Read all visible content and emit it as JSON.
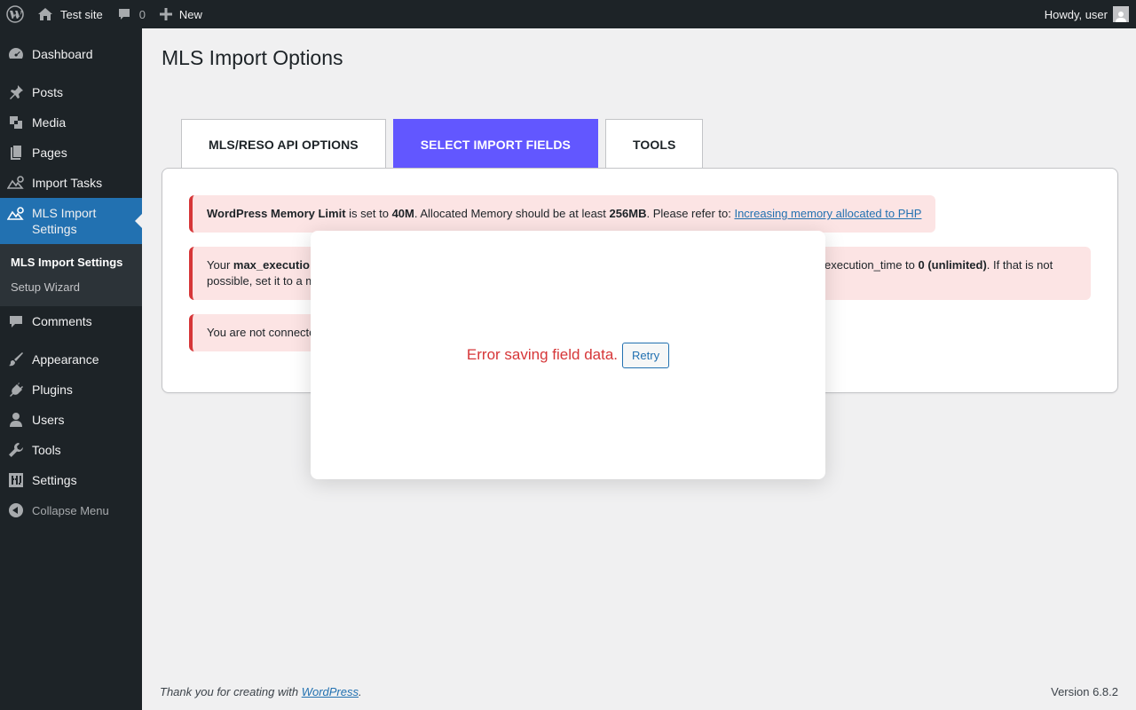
{
  "adminbar": {
    "site_name": "Test site",
    "comments_count": "0",
    "new_label": "New",
    "howdy": "Howdy, user"
  },
  "sidebar": {
    "items": [
      {
        "label": "Dashboard",
        "icon": "dashboard-icon"
      },
      {
        "label": "Posts",
        "icon": "pin-icon"
      },
      {
        "label": "Media",
        "icon": "media-icon"
      },
      {
        "label": "Pages",
        "icon": "pages-icon"
      },
      {
        "label": "Import Tasks",
        "icon": "import-icon"
      },
      {
        "label": "MLS Import Settings",
        "icon": "import-icon"
      },
      {
        "label": "Comments",
        "icon": "comment-icon"
      },
      {
        "label": "Appearance",
        "icon": "brush-icon"
      },
      {
        "label": "Plugins",
        "icon": "plugin-icon"
      },
      {
        "label": "Users",
        "icon": "user-icon"
      },
      {
        "label": "Tools",
        "icon": "wrench-icon"
      },
      {
        "label": "Settings",
        "icon": "settings-icon"
      }
    ],
    "submenu": [
      "MLS Import Settings",
      "Setup Wizard"
    ],
    "collapse": "Collapse Menu"
  },
  "page": {
    "title": "MLS Import Options",
    "tabs": [
      "MLS/RESO API OPTIONS",
      "SELECT IMPORT FIELDS",
      "TOOLS"
    ],
    "active_tab": "SELECT IMPORT FIELDS"
  },
  "notices": {
    "memory": {
      "bold1": "WordPress Memory Limit",
      "t1": " is set to ",
      "bold2": "40M",
      "t2": ". Allocated Memory should be at least ",
      "bold3": "256MB",
      "t3": ". Please refer to: ",
      "link": "Increasing memory allocated to PHP"
    },
    "exec": {
      "t1": "Your ",
      "bold1": "max_executio",
      "t2": "execution_time to ",
      "bold2": "0 (unlimited)",
      "t3": ". If that is not",
      "line2": "possible, set it to a m"
    },
    "connect": {
      "text": "You are not connecte"
    }
  },
  "modal": {
    "error": "Error saving field data.",
    "retry": "Retry"
  },
  "footer": {
    "thanks": "Thank you for creating with ",
    "link": "WordPress",
    "period": ".",
    "version": "Version 6.8.2"
  },
  "colors": {
    "accent": "#6257ff",
    "wp_blue": "#2271b1",
    "error": "#d63638",
    "notice_bg": "#fce4e4"
  }
}
